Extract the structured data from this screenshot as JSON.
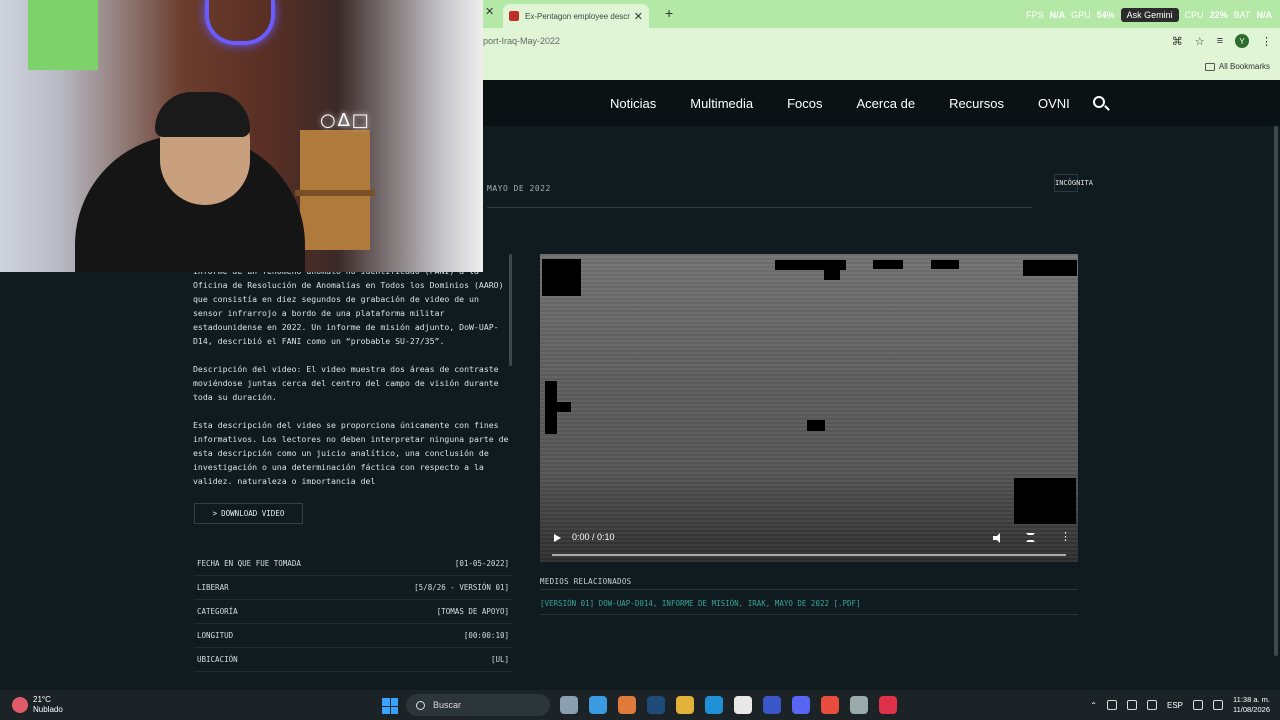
{
  "browser": {
    "tab_title": "Ex-Pentagon employee describ",
    "url": "port-Iraq-May-2022",
    "all_bookmarks": "All Bookmarks",
    "perf": {
      "fps_label": "FPS",
      "fps_value": "N/A",
      "gpu_label": "GPU",
      "gpu_value": "54%",
      "gemini": "Ask Gemini",
      "cpu_label": "CPU",
      "cpu_value": "22%",
      "bat_label": "BAT",
      "bat_value": "N/A"
    },
    "avatar_letter": "Y"
  },
  "webcam": {
    "neon_text": "○∆□"
  },
  "nav": {
    "items": [
      "Noticias",
      "Multimedia",
      "Focos",
      "Acerca de",
      "Recursos",
      "OVNI"
    ]
  },
  "header": {
    "date": "MAYO DE 2022",
    "tag": "INCÓGNITA"
  },
  "description": {
    "p1": "informe de un fenómeno anómalo no identificado (FANI) a la Oficina de Resolución de Anomalías en Todos los Dominios (AARO) que consistía en diez segundos de grabación de video de un sensor infrarrojo a bordo de una plataforma militar estadounidense en 2022. Un informe de misión adjunto, DoW-UAP-D14, describió el FANI como un “probable SU-27/35”.",
    "p2": "Descripción del video: El video muestra dos áreas de contraste moviéndose juntas cerca del centro del campo de visión durante toda su duración.",
    "p3": "Esta descripción del video se proporciona únicamente con fines informativos. Los lectores no deben interpretar ninguna parte de esta descripción como un juicio analítico, una conclusión de investigación o una determinación fáctica con respecto a la validez, naturaleza o importancia del"
  },
  "download": {
    "label": "DOWNLOAD VIDEO",
    "prefix": ">"
  },
  "meta": [
    {
      "label": "FECHA EN QUE FUE TOMADA",
      "value": "[01-05-2022]"
    },
    {
      "label": "LIBERAR",
      "value": "[5/8/26 - VERSIÓN 01]"
    },
    {
      "label": "CATEGORÍA",
      "value": "[TOMAS DE APOYO]"
    },
    {
      "label": "LONGITUD",
      "value": "[00:00:10]"
    },
    {
      "label": "UBICACIÓN",
      "value": "[UL]"
    }
  ],
  "video": {
    "time": "0:00 / 0:10",
    "progress": 0
  },
  "related": {
    "title": "MEDIOS RELACIONADOS",
    "link": "[VERSIÓN 01] DOW-UAP-D014, INFORME DE MISIÓN, IRAK, MAYO DE 2022 [.PDF]"
  },
  "taskbar": {
    "temp": "21°C",
    "weather": "Nublado",
    "search": "Buscar",
    "lang": "ESP",
    "time": "11:38 a. m.",
    "date": "11/08/2026"
  }
}
